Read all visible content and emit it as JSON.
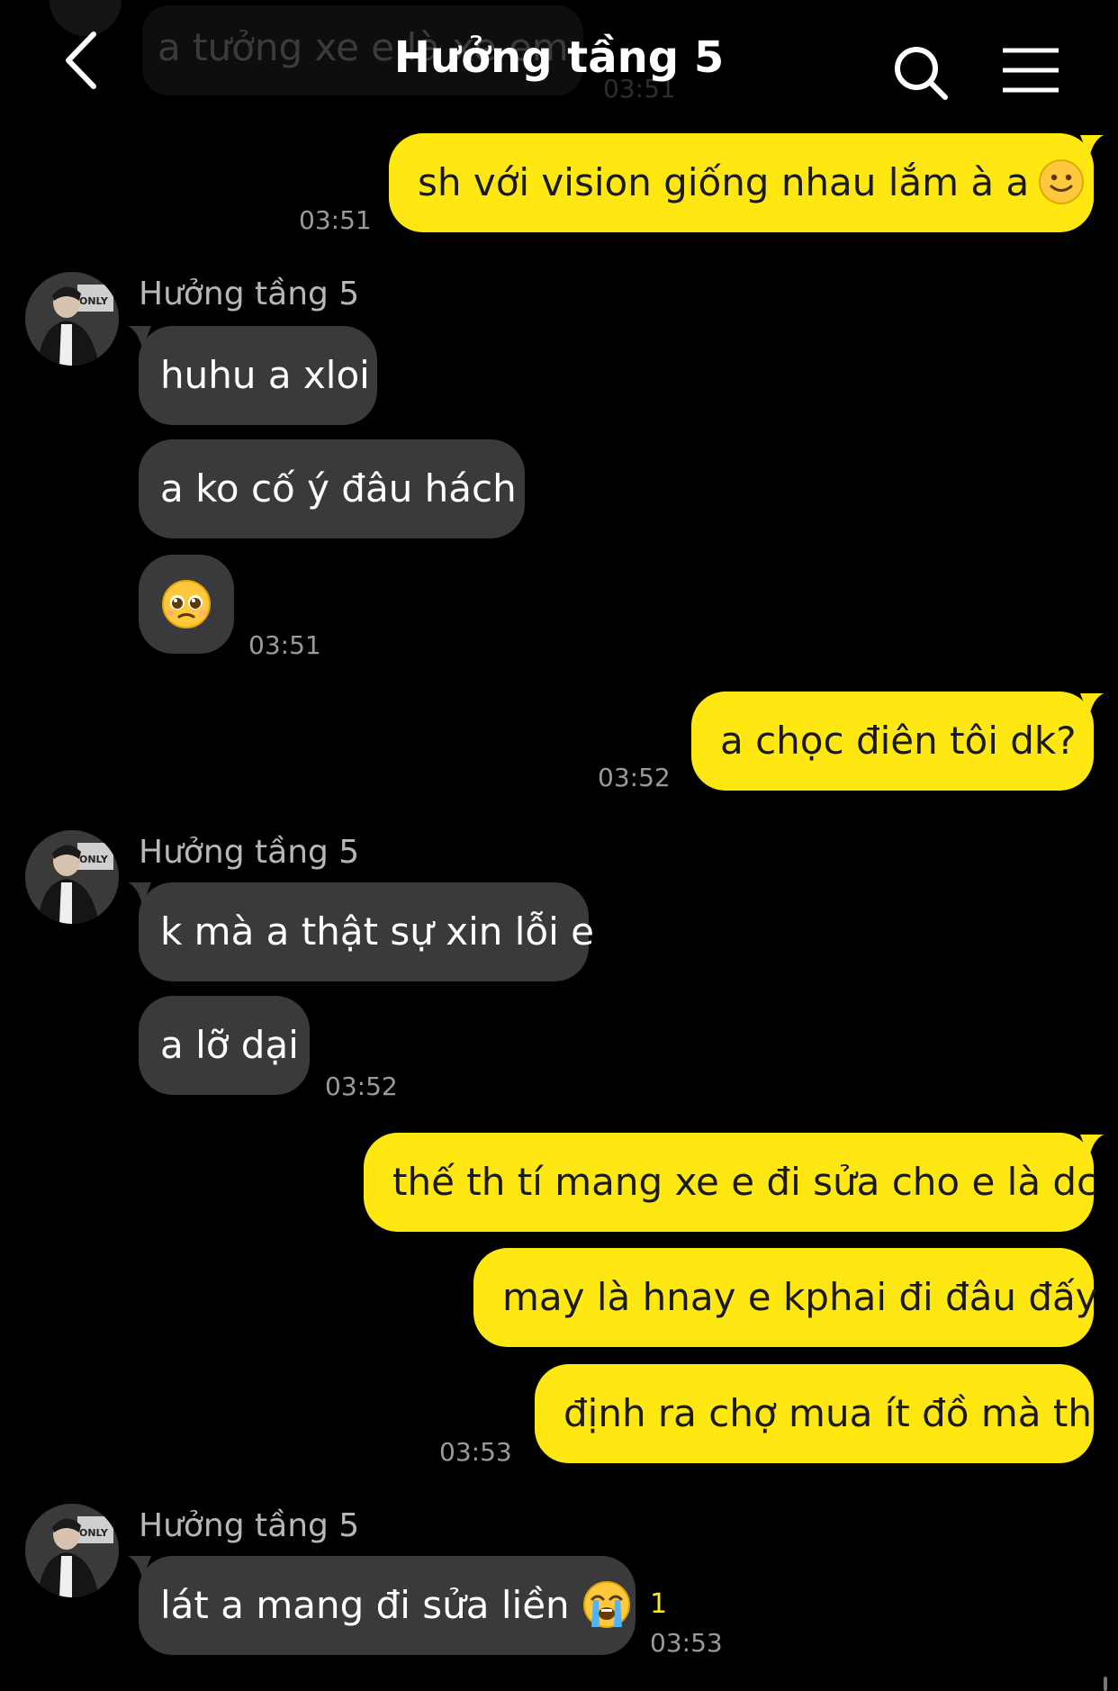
{
  "header": {
    "title": "Hưởng tầng 5",
    "ghost_message": "a tưởng xe e là xe em",
    "ghost_time": "03:51"
  },
  "conversation": {
    "contact_name": "Hưởng tầng 5",
    "messages": [
      {
        "id": "m1",
        "dir": "out",
        "text": "sh với vision giống nhau lắm à a",
        "time": "03:51",
        "emoji": "slightly-smiling-face"
      },
      {
        "id": "m2",
        "dir": "in",
        "text": "huhu a xloi"
      },
      {
        "id": "m3",
        "dir": "in",
        "text": "a ko cố ý đâu hách"
      },
      {
        "id": "m4",
        "dir": "in",
        "text": "",
        "time": "03:51",
        "emoji": "pleading-face"
      },
      {
        "id": "m5",
        "dir": "out",
        "text": "a chọc điên tôi dk?",
        "time": "03:52"
      },
      {
        "id": "m6",
        "dir": "in",
        "text": "k mà a thật sự xin lỗi e"
      },
      {
        "id": "m7",
        "dir": "in",
        "text": "a lỡ dại",
        "time": "03:52"
      },
      {
        "id": "m8",
        "dir": "out",
        "text": "thế th tí mang xe e đi sửa cho e là dc"
      },
      {
        "id": "m9",
        "dir": "out",
        "text": "may là hnay e kphai đi đâu đấy"
      },
      {
        "id": "m10",
        "dir": "out",
        "text": "định ra chợ mua ít đồ mà th",
        "time": "03:53"
      },
      {
        "id": "m11",
        "dir": "in",
        "text": "lát a mang đi sửa liền",
        "time": "03:53",
        "emoji": "loudly-crying-face",
        "unread_count": "1"
      }
    ]
  },
  "colors": {
    "background": "#000000",
    "outgoing_bubble": "#ffe812",
    "incoming_bubble": "#3a3a3c",
    "timestamp": "#9a9a9a",
    "unread_badge": "#ffe812"
  },
  "icons": {
    "back": "chevron-left-icon",
    "search": "search-icon",
    "menu": "hamburger-menu-icon"
  }
}
